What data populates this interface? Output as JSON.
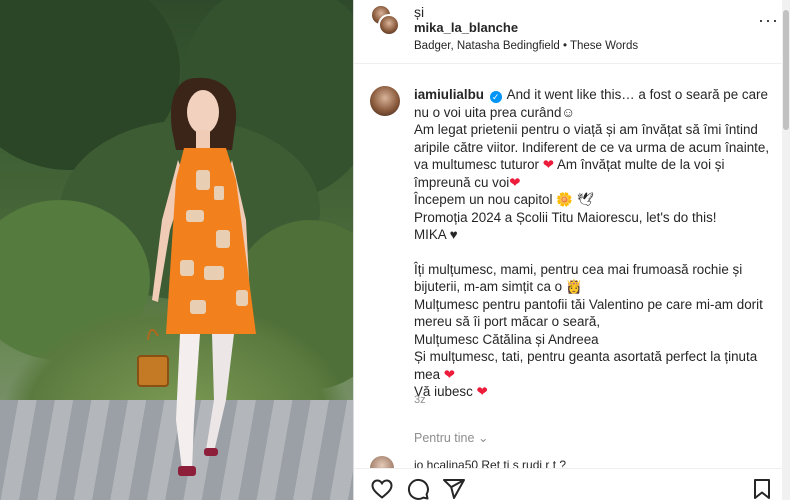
{
  "post": {
    "collab_joiner": "și",
    "second_user": "mika_la_blanche",
    "audio": "Badger, Natasha Bedingfield • These Words",
    "more_icon": "more-horizontal-icon"
  },
  "caption": {
    "author": "iamiulialbu",
    "lines": [
      "And it went like this… a fost o seară pe care nu o voi uita prea curând",
      "Am legat prietenii pentru o viață și am învățat să îmi întind aripile către viitor. Indiferent de ce va urma de acum înainte, va multumesc tuturor",
      "Am învățat multe de la voi și împreună cu voi",
      "Începem un nou capitol",
      "Promoția 2024 a Școlii Titu Maiorescu, let's do this!",
      "MIKA",
      "Îți mulțumesc, mami, pentru cea mai frumoasă rochie și bijuterii, m-am simțit ca o",
      "Mulțumesc pentru pantofii tăi Valentino pe care mi-am dorit mereu să îi port măcar o seară,",
      "Mulțumesc Cătălina și Andreea",
      "Și mulțumesc, tati, pentru geanta asortată perfect la ținuta mea",
      "Vă iubesc"
    ],
    "time": "3z",
    "translate": "Pentru tine"
  },
  "comment_peek": {
    "text": "jo  hcalina50 Ret  ti s   rudi  r  t   ?"
  },
  "colors": {
    "verified": "#0095f6",
    "heart": "#ed1c3a",
    "muted": "#8e8e8e"
  },
  "actions": [
    "like-icon",
    "comment-icon",
    "share-icon",
    "save-icon"
  ]
}
